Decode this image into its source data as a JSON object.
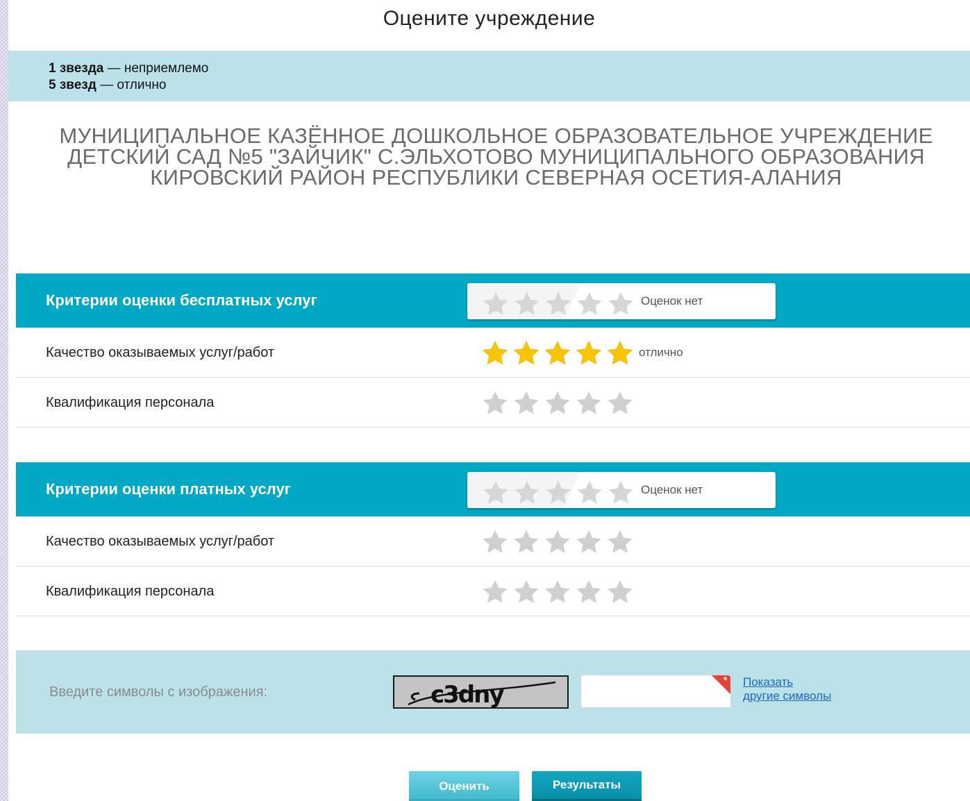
{
  "page": {
    "title": "Оцените учреждение"
  },
  "legend": {
    "line1_bold": "1 звезда",
    "line1_rest": " — неприемлемо",
    "line2_bold": "5 звезд",
    "line2_rest": " — отлично"
  },
  "organization": {
    "name": "МУНИЦИПАЛЬНОЕ КАЗЁННОЕ ДОШКОЛЬНОЕ ОБРАЗОВАТЕЛЬНОЕ УЧРЕЖДЕНИЕ ДЕТСКИЙ САД №5 \"ЗАЙЧИК\" С.ЭЛЬХОТОВО МУНИЦИПАЛЬНОГО ОБРАЗОВАНИЯ КИРОВСКИЙ РАЙОН РЕСПУБЛИКИ СЕВЕРНАЯ ОСЕТИЯ-АЛАНИЯ"
  },
  "sections": [
    {
      "title": "Критерии оценки бесплатных услуг",
      "summary_note": "Оценок нет",
      "summary_rating": 0,
      "rows": [
        {
          "label": "Качество оказываемых услуг/работ",
          "rating": 5,
          "note": "отлично"
        },
        {
          "label": "Квалификация персонала",
          "rating": 0,
          "note": ""
        }
      ]
    },
    {
      "title": "Критерии оценки платных услуг",
      "summary_note": "Оценок нет",
      "summary_rating": 0,
      "rows": [
        {
          "label": "Качество оказываемых услуг/работ",
          "rating": 0,
          "note": ""
        },
        {
          "label": "Квалификация персонала",
          "rating": 0,
          "note": ""
        }
      ]
    }
  ],
  "captcha": {
    "label": "Введите символы с изображения:",
    "image_text": "c3dny",
    "input_value": "",
    "required_mark": "*",
    "refresh_link_line1": "Показать",
    "refresh_link_line2": "другие символы"
  },
  "buttons": {
    "rate_label": "Оценить",
    "results_label": "Результаты"
  },
  "colors": {
    "header_bg": "#00a8c6",
    "band_bg": "#bce2e9",
    "star_filled": "#f7c600",
    "star_empty": "#cfcfcf",
    "required_corner": "#e5443c",
    "link": "#1a66c2"
  },
  "icons": {
    "star": "star-icon",
    "required": "required-marker"
  }
}
